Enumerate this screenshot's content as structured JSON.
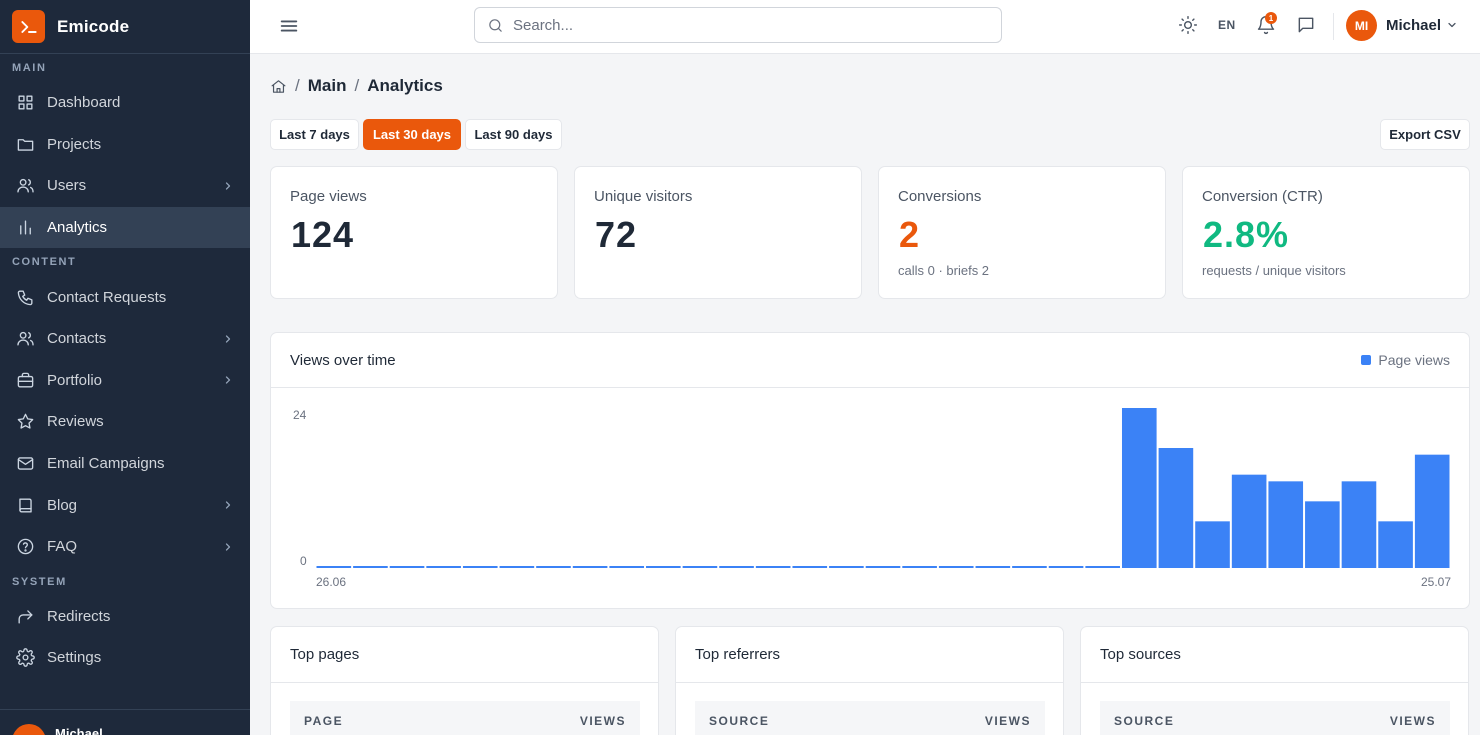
{
  "app": {
    "name": "Emicode"
  },
  "colors": {
    "accent": "#ea580c",
    "sidebar": "#1e293b",
    "bar": "#3b82f6",
    "ctr": "#10b981"
  },
  "sidebar": {
    "sections": [
      {
        "title": "MAIN",
        "items": [
          {
            "label": "Dashboard",
            "icon": "grid-icon",
            "chevron": false,
            "active": false
          },
          {
            "label": "Projects",
            "icon": "folder-icon",
            "chevron": false,
            "active": false
          },
          {
            "label": "Users",
            "icon": "users-icon",
            "chevron": true,
            "active": false
          },
          {
            "label": "Analytics",
            "icon": "bar-chart-icon",
            "chevron": false,
            "active": true
          }
        ]
      },
      {
        "title": "CONTENT",
        "items": [
          {
            "label": "Contact Requests",
            "icon": "phone-icon",
            "chevron": false,
            "active": false
          },
          {
            "label": "Contacts",
            "icon": "users-icon",
            "chevron": true,
            "active": false
          },
          {
            "label": "Portfolio",
            "icon": "briefcase-icon",
            "chevron": true,
            "active": false
          },
          {
            "label": "Reviews",
            "icon": "star-icon",
            "chevron": false,
            "active": false
          },
          {
            "label": "Email Campaigns",
            "icon": "mail-icon",
            "chevron": false,
            "active": false
          },
          {
            "label": "Blog",
            "icon": "book-icon",
            "chevron": true,
            "active": false
          },
          {
            "label": "FAQ",
            "icon": "help-circle-icon",
            "chevron": true,
            "active": false
          }
        ]
      },
      {
        "title": "SYSTEM",
        "items": [
          {
            "label": "Redirects",
            "icon": "redirect-icon",
            "chevron": false,
            "active": false
          },
          {
            "label": "Settings",
            "icon": "gear-icon",
            "chevron": false,
            "active": false
          }
        ]
      }
    ],
    "footer_user": "Michael"
  },
  "topbar": {
    "search_placeholder": "Search...",
    "language": "EN",
    "notification_count": "1",
    "avatar_initials": "MI",
    "user_name": "Michael"
  },
  "breadcrumb": {
    "items": [
      "Main",
      "Analytics"
    ]
  },
  "ranges": [
    {
      "label": "Last 7 days",
      "active": false
    },
    {
      "label": "Last 30 days",
      "active": true
    },
    {
      "label": "Last 90 days",
      "active": false
    }
  ],
  "export_label": "Export CSV",
  "stats": [
    {
      "label": "Page views",
      "value": "124",
      "sub": "",
      "color": "#1f2937"
    },
    {
      "label": "Unique visitors",
      "value": "72",
      "sub": "",
      "color": "#1f2937"
    },
    {
      "label": "Conversions",
      "value": "2",
      "sub": "calls 0 · briefs 2",
      "color": "#ea580c"
    },
    {
      "label": "Conversion (CTR)",
      "value": "2.8%",
      "sub": "requests / unique visitors",
      "color": "#10b981"
    }
  ],
  "chart_data": {
    "type": "bar",
    "title": "Views over time",
    "legend": [
      "Page views"
    ],
    "y_ticks": [
      "24",
      "0"
    ],
    "ylim": [
      0,
      24
    ],
    "x_labels": {
      "first": "26.06",
      "last": "25.07"
    },
    "series": [
      {
        "name": "Page views",
        "values": [
          0,
          0,
          0,
          0,
          0,
          0,
          0,
          0,
          0,
          0,
          0,
          0,
          0,
          0,
          0,
          0,
          0,
          0,
          0,
          0,
          0,
          0,
          24,
          18,
          7,
          14,
          13,
          10,
          13,
          7,
          17
        ]
      }
    ]
  },
  "tables": [
    {
      "title": "Top pages",
      "col1": "PAGE",
      "col2": "VIEWS"
    },
    {
      "title": "Top referrers",
      "col1": "SOURCE",
      "col2": "VIEWS"
    },
    {
      "title": "Top sources",
      "col1": "SOURCE",
      "col2": "VIEWS"
    }
  ]
}
